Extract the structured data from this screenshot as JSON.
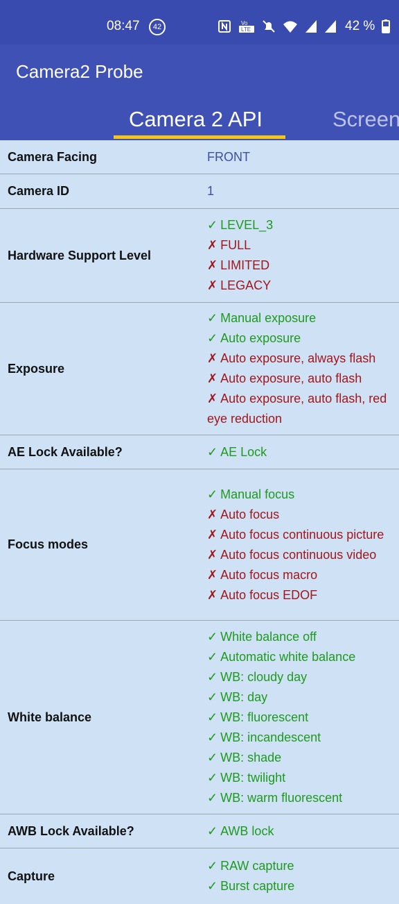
{
  "status_bar": {
    "time": "08:47",
    "notification_count": "42",
    "icons": [
      "nfc-icon",
      "volte-icon",
      "mute-icon",
      "wifi-icon",
      "signal-icon",
      "signal-icon",
      "battery-icon"
    ],
    "battery": "42 %"
  },
  "app_bar": {
    "title": "Camera2 Probe"
  },
  "tabs": [
    {
      "label": "Camera 2 API",
      "active": true
    },
    {
      "label": "Screen",
      "active": false
    }
  ],
  "colors": {
    "status_bar": "#3a4bb0",
    "app_bar": "#3f51b5",
    "tab_indicator": "#f5c518",
    "background": "#cfe2f5",
    "supported": "#1e9a1e",
    "unsupported": "#a3161b",
    "plain_value": "#3c4fa8"
  },
  "marks": {
    "supported": "✓",
    "unsupported": "✗"
  },
  "rows": [
    {
      "label": "Camera Facing",
      "value": "FRONT"
    },
    {
      "label": "Camera ID",
      "value": "1"
    },
    {
      "label": "Hardware Support Level",
      "items": [
        {
          "text": "LEVEL_3",
          "supported": true
        },
        {
          "text": "FULL",
          "supported": false
        },
        {
          "text": "LIMITED",
          "supported": false
        },
        {
          "text": "LEGACY",
          "supported": false
        }
      ]
    },
    {
      "label": "Exposure",
      "items": [
        {
          "text": "Manual exposure",
          "supported": true
        },
        {
          "text": "Auto exposure",
          "supported": true
        },
        {
          "text": "Auto exposure, always flash",
          "supported": false
        },
        {
          "text": "Auto exposure, auto flash",
          "supported": false
        },
        {
          "text": "Auto exposure, auto flash, red eye reduction",
          "supported": false
        }
      ]
    },
    {
      "label": "AE Lock Available?",
      "items": [
        {
          "text": "AE Lock",
          "supported": true
        }
      ]
    },
    {
      "label": "Focus modes",
      "items": [
        {
          "text": "Manual focus",
          "supported": true
        },
        {
          "text": "Auto focus",
          "supported": false
        },
        {
          "text": "Auto focus continuous picture",
          "supported": false
        },
        {
          "text": "Auto focus continuous video",
          "supported": false
        },
        {
          "text": "Auto focus macro",
          "supported": false
        },
        {
          "text": "Auto focus EDOF",
          "supported": false
        }
      ]
    },
    {
      "label": "White balance",
      "items": [
        {
          "text": "White balance off",
          "supported": true
        },
        {
          "text": "Automatic white balance",
          "supported": true
        },
        {
          "text": "WB: cloudy day",
          "supported": true
        },
        {
          "text": "WB: day",
          "supported": true
        },
        {
          "text": "WB: fluorescent",
          "supported": true
        },
        {
          "text": "WB: incandescent",
          "supported": true
        },
        {
          "text": "WB: shade",
          "supported": true
        },
        {
          "text": "WB: twilight",
          "supported": true
        },
        {
          "text": "WB: warm fluorescent",
          "supported": true
        }
      ]
    },
    {
      "label": "AWB Lock Available?",
      "items": [
        {
          "text": "AWB lock",
          "supported": true
        }
      ]
    },
    {
      "label": "Capture",
      "items": [
        {
          "text": "RAW capture",
          "supported": true
        },
        {
          "text": "Burst capture",
          "supported": true
        }
      ]
    }
  ]
}
